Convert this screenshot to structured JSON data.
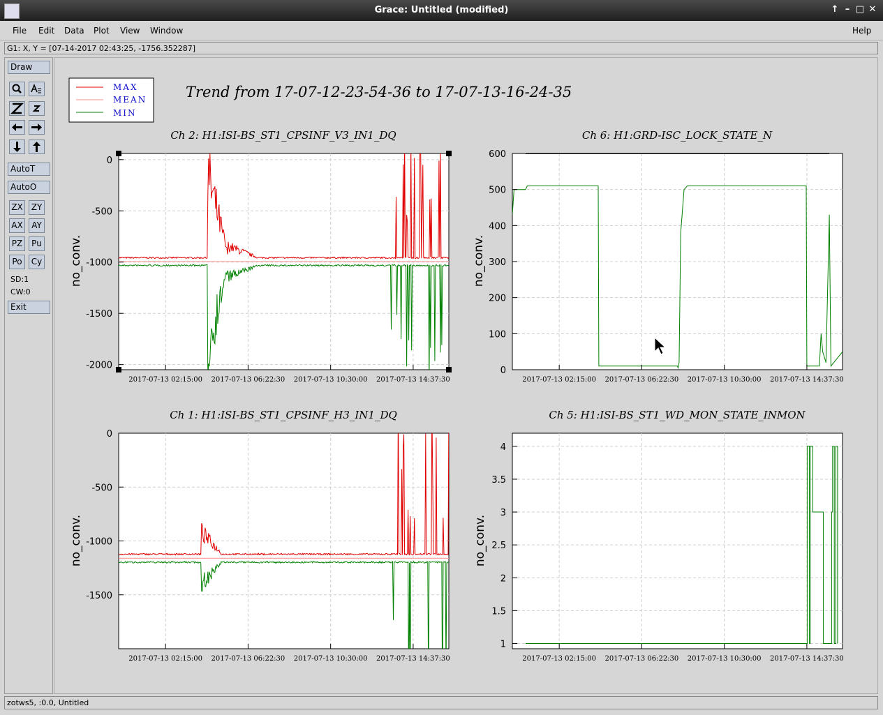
{
  "window": {
    "title": "Grace: Untitled (modified)",
    "buttons": [
      "↑",
      "–",
      "□",
      "✕"
    ]
  },
  "menubar": {
    "items": [
      {
        "label": "File"
      },
      {
        "label": "Edit"
      },
      {
        "label": "Data"
      },
      {
        "label": "Plot"
      },
      {
        "label": "View"
      },
      {
        "label": "Window"
      }
    ],
    "help": "Help"
  },
  "locator": "G1: X, Y = [07-14-2017 02:43:25, -1756.352287]",
  "toolbox": {
    "draw": "Draw",
    "autot": "AutoT",
    "autoo": "AutoO",
    "pairs": [
      [
        "ZX",
        "ZY"
      ],
      [
        "AX",
        "AY"
      ],
      [
        "PZ",
        "Pu"
      ],
      [
        "Po",
        "Cy"
      ]
    ],
    "sd": "SD:1",
    "cw": "CW:0",
    "exit": "Exit"
  },
  "status": "zotws5, :0.0, Untitled",
  "legend": [
    {
      "label": "MAX",
      "color": "#e00000"
    },
    {
      "label": "MEAN",
      "color": "#ff8a8a"
    },
    {
      "label": "MIN",
      "color": "#008000"
    }
  ],
  "chart_data": [
    {
      "type": "line",
      "title": "Ch 2: H1:ISI-BS_ST1_CPSINF_V3_IN1_DQ",
      "ylabel": "no_conv.",
      "yticks": [
        0,
        -500,
        -1000,
        -1500,
        -2000
      ],
      "ylim": [
        -2050,
        60
      ],
      "xticks": [
        "2017-07-13 02:15:00",
        "2017-07-13 06:22:30",
        "2017-07-13 10:30:00",
        "2017-07-13 14:37:30"
      ],
      "header": "Trend from 17-07-12-23-54-36 to 17-07-13-16-24-35"
    },
    {
      "type": "line",
      "title": "Ch 6: H1:GRD-ISC_LOCK_STATE_N",
      "ylabel": "no_conv.",
      "yticks": [
        600,
        500,
        400,
        300,
        200,
        100,
        0
      ],
      "ylim": [
        0,
        600
      ],
      "xticks": [
        "2017-07-13 02:15:00",
        "2017-07-13 06:22:30",
        "2017-07-13 10:30:00",
        "2017-07-13 14:37:30"
      ]
    },
    {
      "type": "line",
      "title": "Ch 1: H1:ISI-BS_ST1_CPSINF_H3_IN1_DQ",
      "ylabel": "no_conv.",
      "yticks": [
        0,
        -500,
        -1000,
        -1500
      ],
      "ylim": [
        -2000,
        0
      ],
      "xticks": [
        "2017-07-13 02:15:00",
        "2017-07-13 06:22:30",
        "2017-07-13 10:30:00",
        "2017-07-13 14:37:30"
      ]
    },
    {
      "type": "line",
      "title": "Ch 5: H1:ISI-BS_ST1_WD_MON_STATE_INMON",
      "ylabel": "no_conv.",
      "yticks": [
        4,
        3.5,
        3,
        2.5,
        2,
        1.5,
        1
      ],
      "ylim": [
        0.92,
        4.2
      ],
      "xticks": [
        "2017-07-13 02:15:00",
        "2017-07-13 06:22:30",
        "2017-07-13 10:30:00",
        "2017-07-13 14:37:30"
      ]
    }
  ]
}
